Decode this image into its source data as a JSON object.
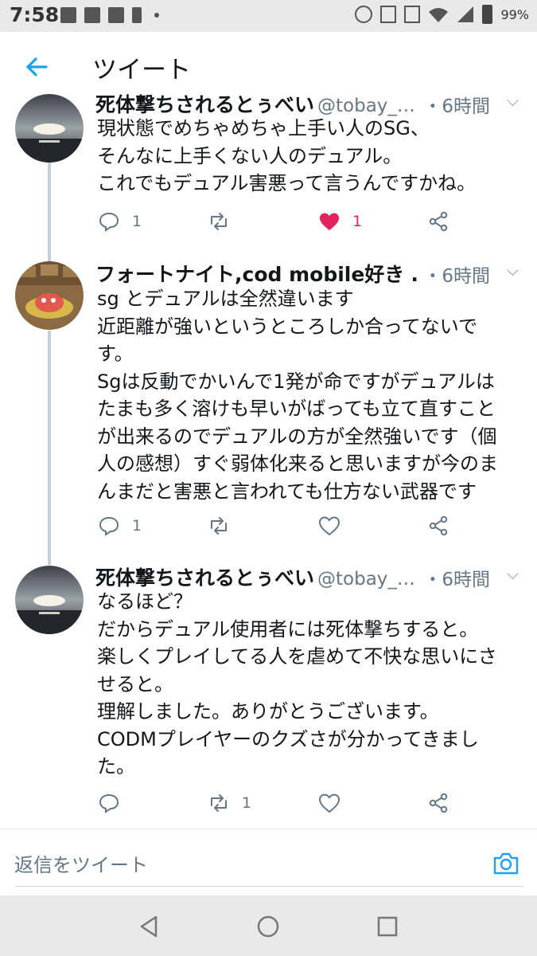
{
  "status_bar": {
    "time": "7:58",
    "battery": "99%",
    "icons": [
      "image-icon",
      "sd-card-icon",
      "network-icon",
      "battery-charging-icon",
      "data-saver-icon",
      "nfc-icon",
      "vibrate-icon",
      "wifi-icon",
      "signal-icon",
      "battery-icon"
    ]
  },
  "header": {
    "title": "ツイート",
    "back_icon": "arrow-left-icon"
  },
  "colors": {
    "accent": "#1da1f2",
    "like": "#e0245e",
    "meta": "#657786",
    "thread_line": "#c4cfd6"
  },
  "tweets": [
    {
      "name": "死体撃ちされるとぅべい",
      "handle": "@tobay_…",
      "time": "・6時間",
      "text": "現状態でめちゃめちゃ上手い人のSG、\nそんなに上手くない人のデュアル。\nこれでもデュアル害悪って言うんですかね。",
      "replies": "1",
      "retweets": "",
      "likes": "1",
      "liked": true
    },
    {
      "name": "フォートナイト,cod mobile好き …",
      "handle": "",
      "time": "・6時間",
      "text": "sg とデュアルは全然違います\n近距離が強いというところしか合ってないで\nす。\nSgは反動でかいんで1発が命ですがデュアルは\nたまも多く溶けも早いがばっても立て直すこと\nが出来るのでデュアルの方が全然強いです（個\n人の感想）すぐ弱体化来ると思いますが今のま\nんまだと害悪と言われても仕方ない武器です",
      "replies": "1",
      "retweets": "",
      "likes": "",
      "liked": false
    },
    {
      "name": "死体撃ちされるとぅべい",
      "handle": "@tobay_…",
      "time": "・6時間",
      "text": "なるほど？\nだからデュアル使用者には死体撃ちすると。\n楽しくプレイしてる人を虐めて不快な思いにさ\nせると。\n理解しました。ありがとうございます。\nCODMプレイヤーのクズさが分かってきまし\nた。",
      "replies": "",
      "retweets": "1",
      "likes": "",
      "liked": false
    }
  ],
  "reply_box": {
    "placeholder": "返信をツイート",
    "camera_icon": "camera-icon"
  },
  "nav_bar": {
    "icons": [
      "back-triangle-icon",
      "home-circle-icon",
      "recents-square-icon"
    ]
  }
}
